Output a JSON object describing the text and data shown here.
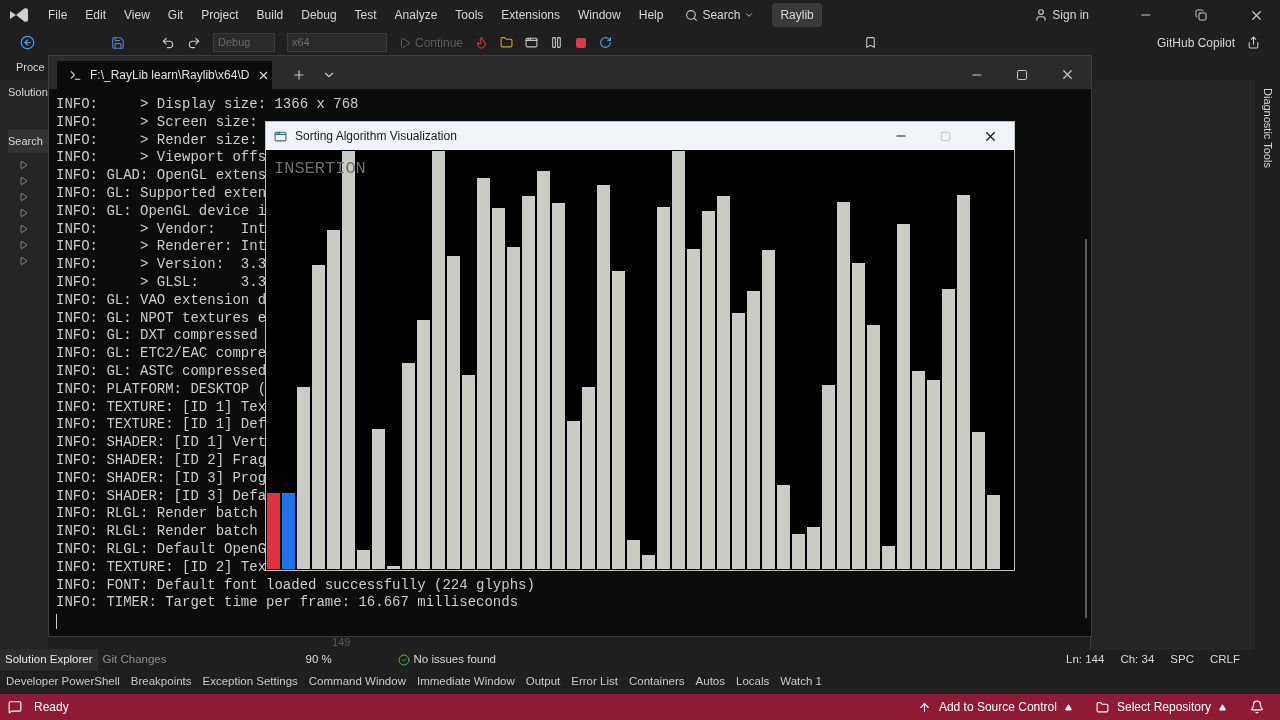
{
  "menu_bar": {
    "items": [
      "File",
      "Edit",
      "View",
      "Git",
      "Project",
      "Build",
      "Debug",
      "Test",
      "Analyze",
      "Tools",
      "Extensions",
      "Window",
      "Help"
    ],
    "search": "Search",
    "solution_name": "Raylib",
    "sign_in": "Sign in"
  },
  "toolbar": {
    "configuration": "Debug",
    "platform": "x64",
    "continue": "Continue",
    "copilot": "GitHub Copilot"
  },
  "process_label": "Proce",
  "solution_explorer": {
    "title": "Solution",
    "search": "Search"
  },
  "console": {
    "tab_title": "F:\\_RayLib learn\\Raylib\\x64\\D",
    "lines": [
      "INFO:     > Display size: 1366 x 768",
      "INFO:     > Screen size:",
      "INFO:     > Render size:",
      "INFO:     > Viewport offs",
      "INFO: GLAD: OpenGL extens",
      "INFO: GL: Supported exten",
      "INFO: GL: OpenGL device i",
      "INFO:     > Vendor:   Int",
      "INFO:     > Renderer: Int",
      "INFO:     > Version:  3.3",
      "INFO:     > GLSL:     3.3",
      "INFO: GL: VAO extension d",
      "INFO: GL: NPOT textures e",
      "INFO: GL: DXT compressed",
      "INFO: GL: ETC2/EAC compre",
      "INFO: GL: ASTC compressed",
      "INFO: PLATFORM: DESKTOP (",
      "INFO: TEXTURE: [ID 1] Tex",
      "INFO: TEXTURE: [ID 1] Def",
      "INFO: SHADER: [ID 1] Vert",
      "INFO: SHADER: [ID 2] Frag",
      "INFO: SHADER: [ID 3] Prog",
      "INFO: SHADER: [ID 3] Defa",
      "INFO: RLGL: Render batch",
      "INFO: RLGL: Render batch",
      "INFO: RLGL: Default OpenG",
      "INFO: TEXTURE: [ID 2] Tex",
      "INFO: FONT: Default font loaded successfully (224 glyphs)",
      "INFO: TIMER: Target time per frame: 16.667 milliseconds"
    ]
  },
  "sort_window": {
    "title": "Sorting Algorithm Visualization",
    "algorithm": "INSERTION"
  },
  "diagnostic_tab": "Diagnostic Tools",
  "editor_status": {
    "line_number": "149",
    "panel_tabs": [
      {
        "label": "Solution Explorer",
        "selected": true
      },
      {
        "label": "Git Changes",
        "selected": false
      }
    ],
    "zoom": "90 %",
    "issues": "No issues found",
    "line": "Ln: 144",
    "column": "Ch: 34",
    "indent": "SPC",
    "line_ending": "CRLF"
  },
  "tool_tabs": [
    "Developer PowerShell",
    "Breakpoints",
    "Exception Settings",
    "Command Window",
    "Immediate Window",
    "Output",
    "Error List",
    "Containers",
    "Autos",
    "Locals",
    "Watch 1"
  ],
  "status_bar": {
    "state": "Ready",
    "source_control": "Add to Source Control",
    "repository": "Select Repository"
  }
}
